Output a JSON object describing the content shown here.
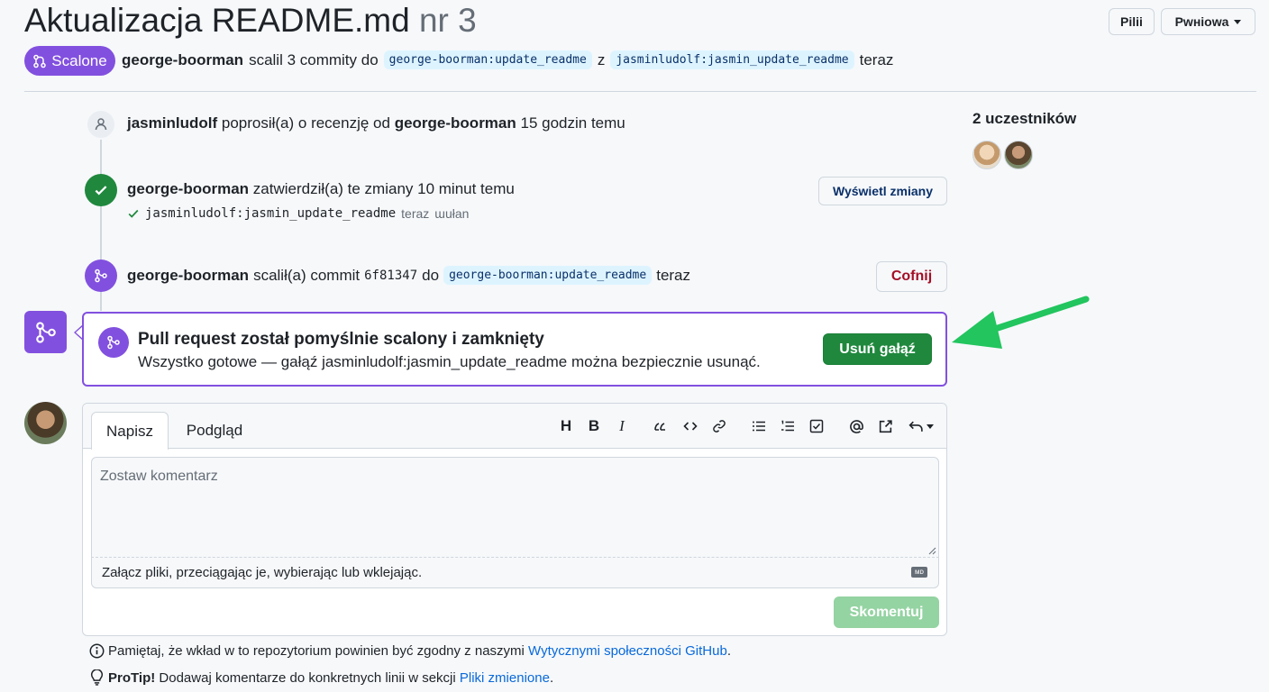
{
  "header": {
    "title": "Aktualizacja README.md",
    "number": "nr 3",
    "btn_left": "Pilii",
    "btn_right": "Pwнiowa",
    "status": "Scalone",
    "summary": {
      "user": "george-boorman",
      "text_a": "scalil 3 commity do",
      "base": "george-boorman:update_readme",
      "text_b": "z",
      "head": "jasminludolf:jasmin_update_readme",
      "time": "teraz"
    }
  },
  "sidebar": {
    "participants_label": "2 uczestników"
  },
  "timeline": {
    "review": {
      "user": "jasminludolf",
      "text": "poprosił(a) o recenzję od",
      "reviewer": "george-boorman",
      "time": "15 godzin temu"
    },
    "approve": {
      "user": "george-boorman",
      "text": "zatwierdził(a) te zmiany 10 minut temu",
      "branch": "jasminludolf:jasmin_update_readme",
      "sub_time": "teraz",
      "sub_extra": "ɯułan",
      "button": "Wyświetl zmiany"
    },
    "merge": {
      "user": "george-boorman",
      "text_a": "scalił(a) commit",
      "sha": "6f81347",
      "text_b": "do",
      "branch": "george-boorman:update_readme",
      "time": "teraz",
      "button": "Cofnij"
    }
  },
  "merged_box": {
    "title": "Pull request został pomyślnie scalony i zamknięty",
    "desc": "Wszystko gotowe — gałąź jasminludolf:jasmin_update_readme można bezpiecznie usunąć.",
    "button": "Usuń gałąź"
  },
  "comment": {
    "tab_write": "Napisz",
    "tab_preview": "Podgląd",
    "placeholder": "Zostaw komentarz",
    "attach": "Załącz pliki, przeciągając je, wybierając lub wklejając.",
    "markdown_badge": "ᴍᴅ",
    "submit": "Skomentuj",
    "heading_icon": "H",
    "bold_icon": "B",
    "italic_icon": "I"
  },
  "footer": {
    "note_text": "Pamiętaj, że wkład w to repozytorium powinien być zgodny z naszymi",
    "note_link": "Wytycznymi społeczności GitHub",
    "note_end": ".",
    "tip_label": "ProTip!",
    "tip_text": "Dodawaj komentarze do konkretnych linii w sekcji",
    "tip_link": "Pliki zmienione",
    "tip_end": "."
  },
  "colors": {
    "merged": "#8250df",
    "success": "#1f883d",
    "success_disabled": "#94d3a2",
    "danger": "#a40e26",
    "arrow": "#22c55e"
  },
  "icons": [
    "merge-icon",
    "person-icon",
    "check-icon",
    "arrow-icon",
    "info-icon",
    "lightbulb-icon",
    "avatar"
  ]
}
